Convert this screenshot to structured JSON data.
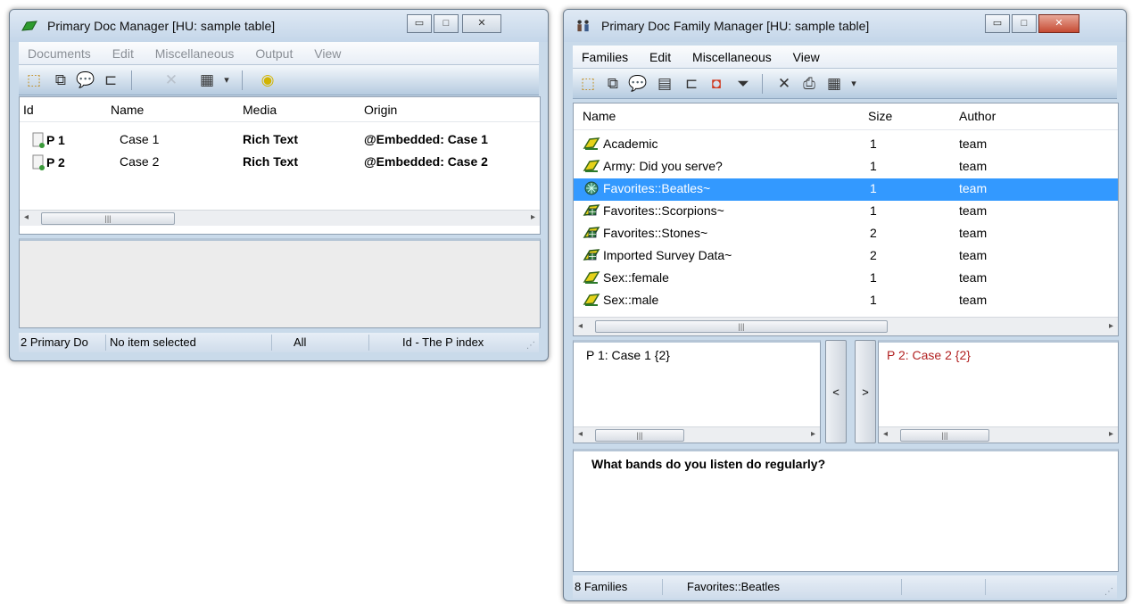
{
  "left_window": {
    "title": "Primary Doc Manager [HU: sample table]",
    "menu": [
      "Documents",
      "Edit",
      "Miscellaneous",
      "Output",
      "View"
    ],
    "columns": [
      "Id",
      "Name",
      "Media",
      "Origin"
    ],
    "rows": [
      {
        "id": "P 1",
        "name": "Case 1",
        "media": "Rich Text",
        "origin": "@Embedded: Case 1"
      },
      {
        "id": "P 2",
        "name": "Case 2",
        "media": "Rich Text",
        "origin": "@Embedded: Case 2"
      }
    ],
    "status": {
      "count": "2 Primary Do",
      "selection": "No item selected",
      "filter": "All",
      "sort": "Id - The P index"
    }
  },
  "right_window": {
    "title": "Primary Doc Family Manager [HU: sample table]",
    "menu": [
      "Families",
      "Edit",
      "Miscellaneous",
      "View"
    ],
    "columns": [
      "Name",
      "Size",
      "Author"
    ],
    "rows": [
      {
        "name": "Academic",
        "size": "1",
        "author": "team",
        "icon": "yellow-family-icon"
      },
      {
        "name": "Army: Did you serve?",
        "size": "1",
        "author": "team",
        "icon": "yellow-family-icon"
      },
      {
        "name": "Favorites::Beatles~",
        "size": "1",
        "author": "team",
        "icon": "grid-family-icon",
        "selected": true
      },
      {
        "name": "Favorites::Scorpions~",
        "size": "1",
        "author": "team",
        "icon": "table-family-icon"
      },
      {
        "name": "Favorites::Stones~",
        "size": "2",
        "author": "team",
        "icon": "table-family-icon"
      },
      {
        "name": "Imported Survey Data~",
        "size": "2",
        "author": "team",
        "icon": "table-family-icon"
      },
      {
        "name": "Sex::female",
        "size": "1",
        "author": "team",
        "icon": "yellow-family-icon"
      },
      {
        "name": "Sex::male",
        "size": "1",
        "author": "team",
        "icon": "yellow-family-icon"
      }
    ],
    "members_in": "P 1: Case 1 {2}",
    "members_out": "P 2: Case 2 {2}",
    "move_left": "<",
    "move_right": ">",
    "comment": "What bands do you listen do regularly?",
    "status": {
      "count": "8 Families",
      "selected": "Favorites::Beatles"
    }
  },
  "colors": {
    "selection": "#3399ff",
    "out_member_text": "#b22222",
    "window_frame": "#c9daea"
  }
}
